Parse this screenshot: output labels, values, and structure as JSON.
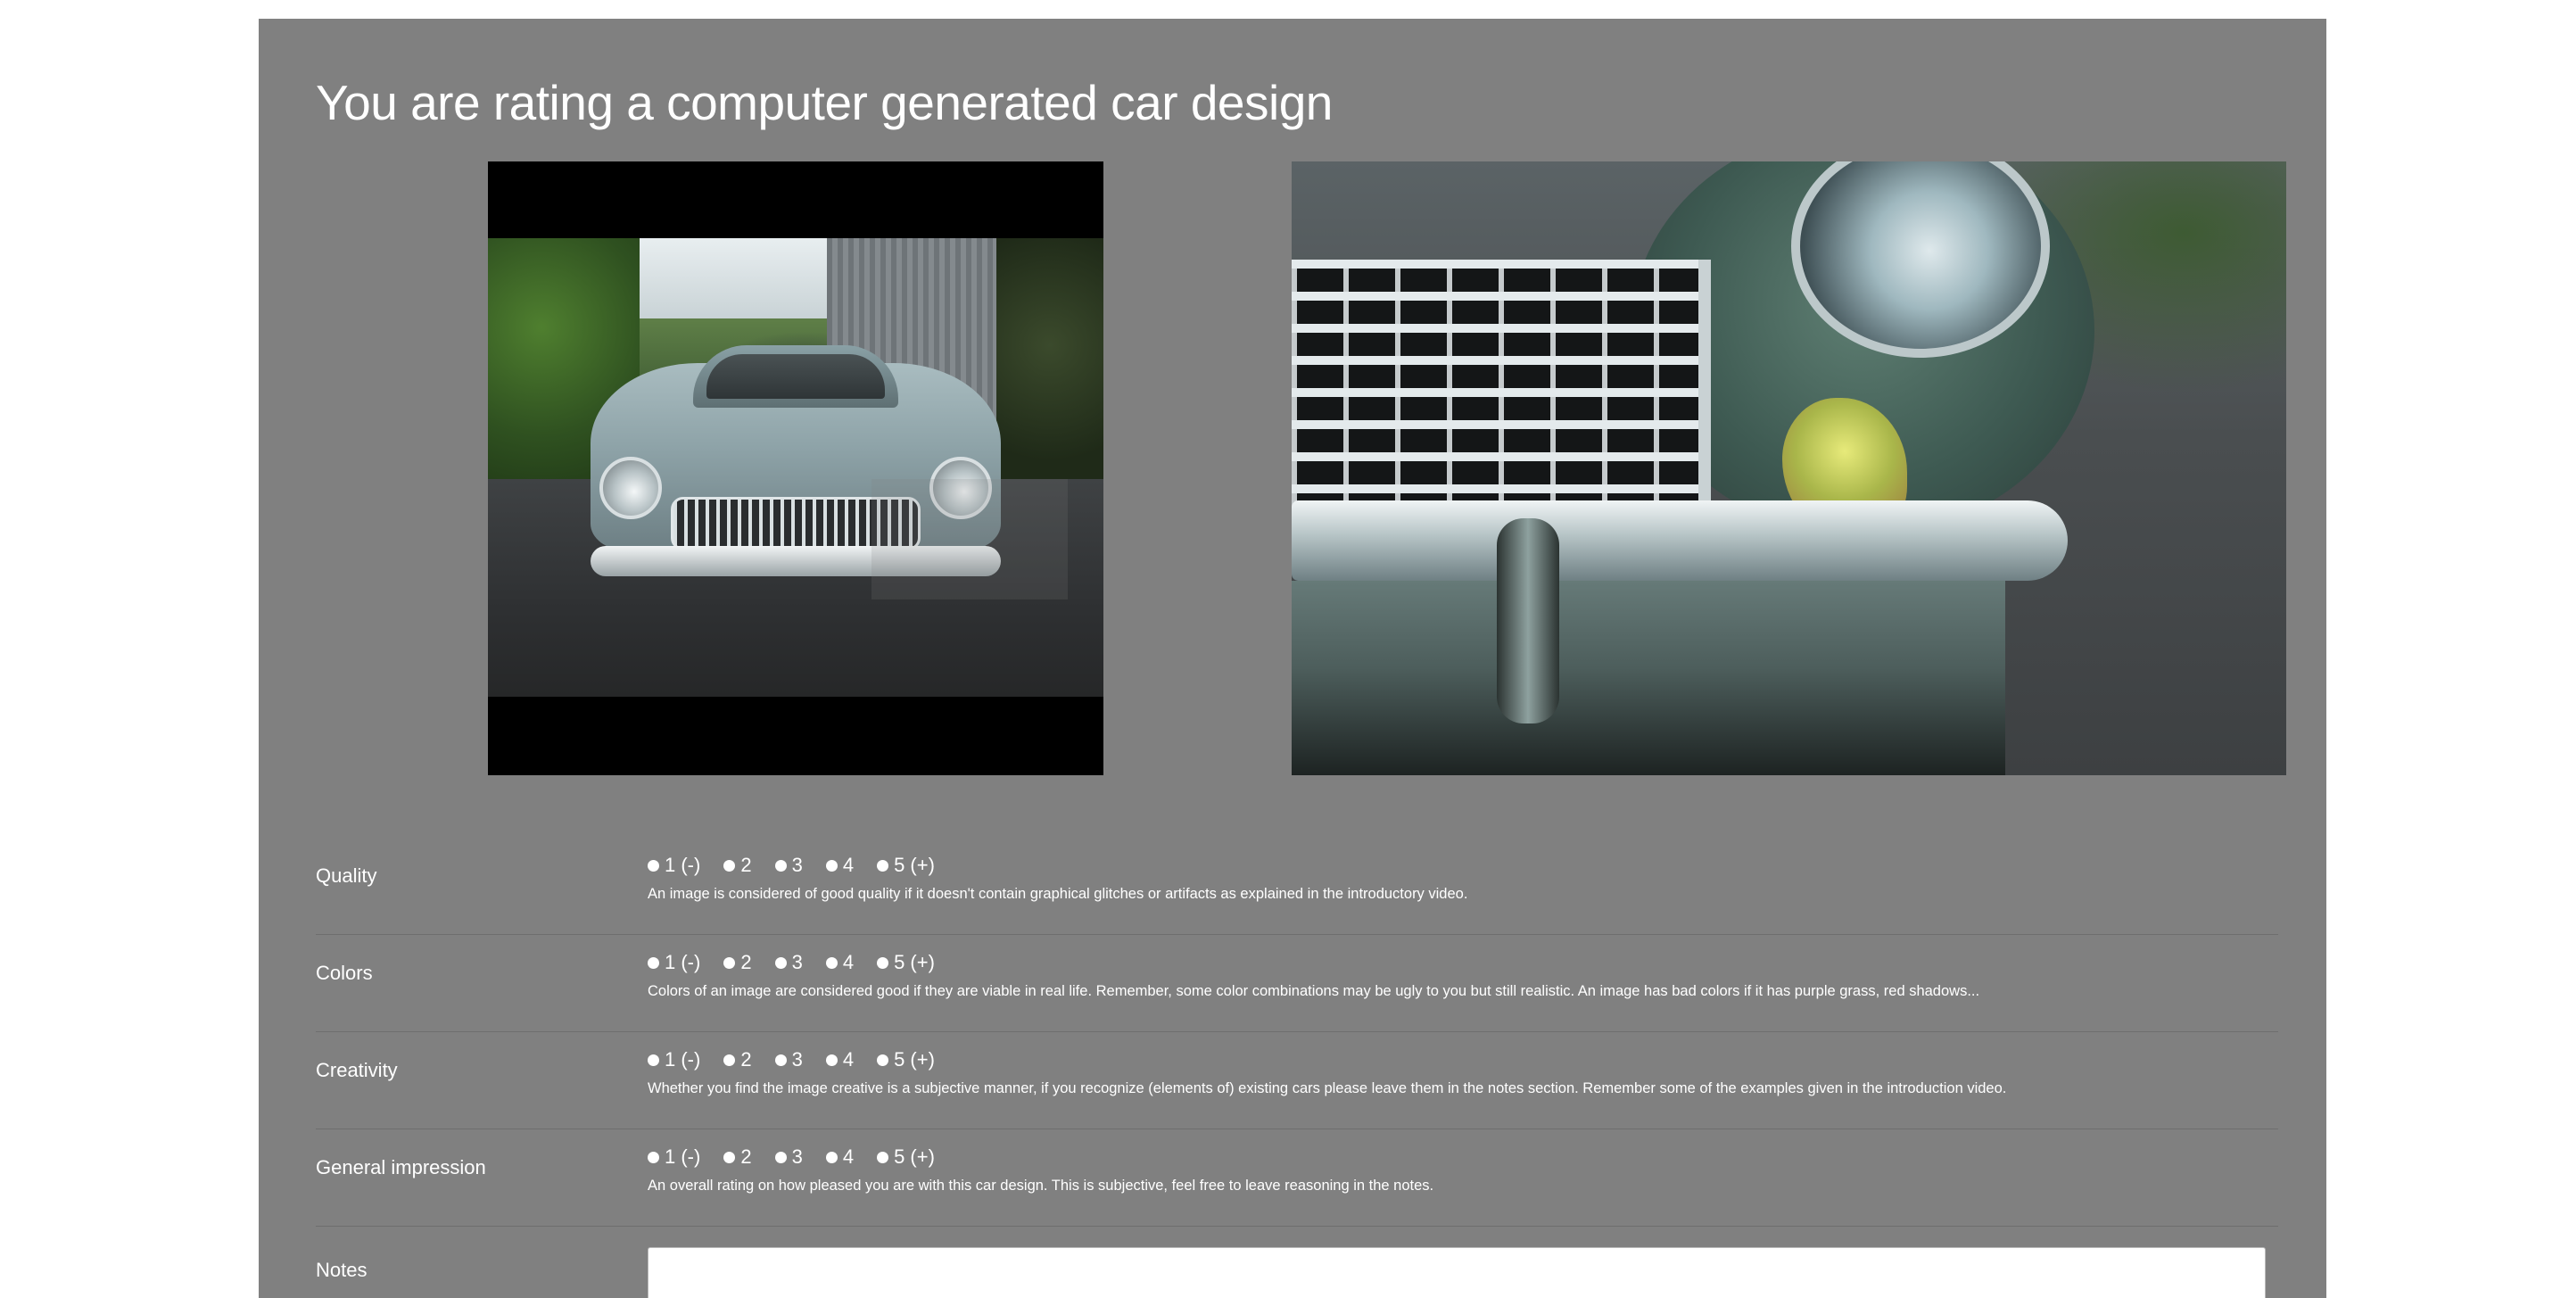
{
  "page": {
    "title": "You are rating a computer generated car design"
  },
  "images": {
    "left_icon": "car-photo-image",
    "right_icon": "generated-car-detail-image"
  },
  "rating_rows": [
    {
      "label": "Quality",
      "options": [
        "1 (-)",
        "2",
        "3",
        "4",
        "5 (+)"
      ],
      "description": "An image is considered of good quality if it doesn't contain graphical glitches or artifacts as explained in the introductory video."
    },
    {
      "label": "Colors",
      "options": [
        "1 (-)",
        "2",
        "3",
        "4",
        "5 (+)"
      ],
      "description": "Colors of an image are considered good if they are viable in real life. Remember, some color combinations may be ugly to you but still realistic. An image has bad colors if it has purple grass, red shadows..."
    },
    {
      "label": "Creativity",
      "options": [
        "1 (-)",
        "2",
        "3",
        "4",
        "5 (+)"
      ],
      "description": "Whether you find the image creative is a subjective manner, if you recognize (elements of) existing cars please leave them in the notes section. Remember some of the examples given in the introduction video."
    },
    {
      "label": "General impression",
      "options": [
        "1 (-)",
        "2",
        "3",
        "4",
        "5 (+)"
      ],
      "description": "An overall rating on how pleased you are with this car design. This is subjective, feel free to leave reasoning in the notes."
    }
  ],
  "notes": {
    "label": "Notes",
    "value": ""
  },
  "colors": {
    "panel_bg": "#808080",
    "page_bg": "#ffffff",
    "text": "#ffffff"
  }
}
